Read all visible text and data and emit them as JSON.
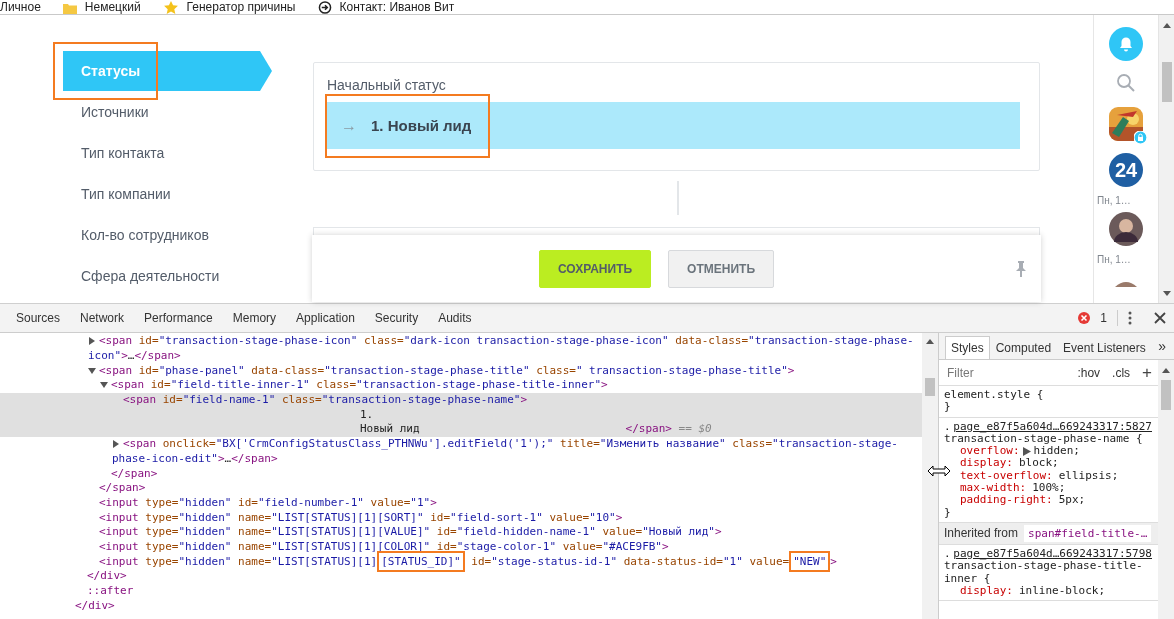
{
  "bookmarks": [
    {
      "label": "Личное",
      "kind": "none"
    },
    {
      "label": "Немецкий",
      "kind": "folder"
    },
    {
      "label": "Генератор причины",
      "kind": "star"
    },
    {
      "label": "Контакт: Иванов Вит",
      "kind": "arrow"
    }
  ],
  "nav": {
    "items": [
      {
        "label": "Статусы",
        "selected": true,
        "outlined": true
      },
      {
        "label": "Источники",
        "selected": false,
        "outlined": false
      },
      {
        "label": "Тип контакта",
        "selected": false,
        "outlined": false
      },
      {
        "label": "Тип компании",
        "selected": false,
        "outlined": false
      },
      {
        "label": "Кол-во сотрудников",
        "selected": false,
        "outlined": false
      },
      {
        "label": "Сфера деятельности",
        "selected": false,
        "outlined": false
      }
    ]
  },
  "status_card": {
    "label": "Начальный статус",
    "stage": {
      "arrow": "→",
      "name": "1. Новый лид",
      "outlined": true
    }
  },
  "footer": {
    "buttons": [
      {
        "label": "СОХРАНИТЬ",
        "kind": "primary"
      },
      {
        "label": "ОТМЕНИТЬ",
        "kind": "secondary"
      }
    ]
  },
  "right_bar": {
    "items": [
      {
        "kind": "bell"
      },
      {
        "kind": "search"
      },
      {
        "kind": "picture"
      },
      {
        "kind": "counter",
        "text": "24",
        "caption": "Пн, 1…"
      },
      {
        "kind": "avatar",
        "caption": "Пн, 1…"
      },
      {
        "kind": "avatar-cut"
      }
    ]
  },
  "devtools": {
    "tabs": [
      {
        "label": "Sources",
        "selected": false
      },
      {
        "label": "Network",
        "selected": false
      },
      {
        "label": "Performance",
        "selected": false
      },
      {
        "label": "Memory",
        "selected": false
      },
      {
        "label": "Application",
        "selected": false
      },
      {
        "label": "Security",
        "selected": false
      },
      {
        "label": "Audits",
        "selected": false
      }
    ],
    "errors": "1",
    "dom_tree": [
      {
        "children": [
          {
            "children": [
              {
                "expanded": false,
                "lines": [
                  [
                    {
                      "kind": "tag",
                      "text": "<span"
                    },
                    {
                      "kind": "attr",
                      "text": " id="
                    },
                    {
                      "kind": "val",
                      "text": "\"transaction-stage-phase-icon\""
                    },
                    {
                      "kind": "attr",
                      "text": " class="
                    },
                    {
                      "kind": "val",
                      "text": "\"dark-icon transaction-stage-phase-icon\""
                    },
                    {
                      "kind": "attr",
                      "text": " data-class="
                    },
                    {
                      "kind": "val",
                      "text": "\"transaction-stage-phase-"
                    }
                  ],
                  [
                    {
                      "kind": "val",
                      "text": "icon\""
                    },
                    {
                      "kind": "tag",
                      "text": ">"
                    },
                    {
                      "kind": "text",
                      "text": "…"
                    },
                    {
                      "kind": "tag",
                      "text": "</span>"
                    }
                  ]
                ]
              },
              {
                "expanded": true,
                "lines": [
                  [
                    {
                      "kind": "tag",
                      "text": "<span"
                    },
                    {
                      "kind": "attr",
                      "text": " id="
                    },
                    {
                      "kind": "val",
                      "text": "\"phase-panel\""
                    },
                    {
                      "kind": "attr",
                      "text": " data-class="
                    },
                    {
                      "kind": "val",
                      "text": "\"transaction-stage-phase-title\""
                    },
                    {
                      "kind": "attr",
                      "text": " class="
                    },
                    {
                      "kind": "val",
                      "text": "\" transaction-stage-phase-title\""
                    },
                    {
                      "kind": "tag",
                      "text": ">"
                    }
                  ]
                ],
                "children": [
                  {
                    "expanded": true,
                    "lines": [
                      [
                        {
                          "kind": "tag",
                          "text": "<span"
                        },
                        {
                          "kind": "attr",
                          "text": " id="
                        },
                        {
                          "kind": "val",
                          "text": "\"field-title-inner-1\""
                        },
                        {
                          "kind": "attr",
                          "text": " class="
                        },
                        {
                          "kind": "val",
                          "text": "\"transaction-stage-phase-title-inner\""
                        },
                        {
                          "kind": "tag",
                          "text": ">"
                        }
                      ]
                    ],
                    "children": [
                      {
                        "selected": true,
                        "lines": [
                          [
                            {
                              "kind": "tag",
                              "text": "<span"
                            },
                            {
                              "kind": "attr",
                              "text": " id="
                            },
                            {
                              "kind": "val",
                              "text": "\"field-name-1\""
                            },
                            {
                              "kind": "attr",
                              "text": " class="
                            },
                            {
                              "kind": "val",
                              "text": "\"transaction-stage-phase-name\""
                            },
                            {
                              "kind": "tag",
                              "text": ">"
                            }
                          ],
                          [
                            {
                              "kind": "content",
                              "text": "1."
                            }
                          ],
                          [
                            {
                              "kind": "content",
                              "text": "Новый лид"
                            },
                            {
                              "kind": "tag",
                              "text": "</span>"
                            },
                            {
                              "kind": "ref",
                              "text": " == $0"
                            }
                          ]
                        ]
                      },
                      {
                        "expanded": false,
                        "lines": [
                          [
                            {
                              "kind": "tag",
                              "text": "<span"
                            },
                            {
                              "kind": "attr",
                              "text": " onclick="
                            },
                            {
                              "kind": "val",
                              "text": "\"BX['CrmConfigStatusClass_PTHNWu'].editField('1');\""
                            },
                            {
                              "kind": "attr",
                              "text": " title="
                            },
                            {
                              "kind": "val",
                              "text": "\"Изменить название\""
                            },
                            {
                              "kind": "attr",
                              "text": " class="
                            },
                            {
                              "kind": "val",
                              "text": "\"transaction-stage-"
                            }
                          ],
                          [
                            {
                              "kind": "val",
                              "text": "phase-icon-edit\""
                            },
                            {
                              "kind": "tag",
                              "text": ">"
                            },
                            {
                              "kind": "text",
                              "text": "…"
                            },
                            {
                              "kind": "tag",
                              "text": "</span>"
                            }
                          ]
                        ]
                      }
                    ],
                    "closing": [
                      {
                        "kind": "tag",
                        "text": "</span>"
                      }
                    ]
                  }
                ],
                "closing": [
                  {
                    "kind": "tag",
                    "text": "</span>"
                  }
                ]
              },
              {
                "lines": [
                  [
                    {
                      "kind": "tag",
                      "text": "<input"
                    },
                    {
                      "kind": "attr",
                      "text": " type="
                    },
                    {
                      "kind": "val",
                      "text": "\"hidden\""
                    },
                    {
                      "kind": "attr",
                      "text": " id="
                    },
                    {
                      "kind": "val",
                      "text": "\"field-number-1\""
                    },
                    {
                      "kind": "attr",
                      "text": " value="
                    },
                    {
                      "kind": "val",
                      "text": "\"1\""
                    },
                    {
                      "kind": "tag",
                      "text": ">"
                    }
                  ]
                ]
              },
              {
                "lines": [
                  [
                    {
                      "kind": "tag",
                      "text": "<input"
                    },
                    {
                      "kind": "attr",
                      "text": " type="
                    },
                    {
                      "kind": "val",
                      "text": "\"hidden\""
                    },
                    {
                      "kind": "attr",
                      "text": " name="
                    },
                    {
                      "kind": "val",
                      "text": "\"LIST[STATUS][1][SORT]\""
                    },
                    {
                      "kind": "attr",
                      "text": " id="
                    },
                    {
                      "kind": "val",
                      "text": "\"field-sort-1\""
                    },
                    {
                      "kind": "attr",
                      "text": " value="
                    },
                    {
                      "kind": "val",
                      "text": "\"10\""
                    },
                    {
                      "kind": "tag",
                      "text": ">"
                    }
                  ]
                ]
              },
              {
                "lines": [
                  [
                    {
                      "kind": "tag",
                      "text": "<input"
                    },
                    {
                      "kind": "attr",
                      "text": " type="
                    },
                    {
                      "kind": "val",
                      "text": "\"hidden\""
                    },
                    {
                      "kind": "attr",
                      "text": " name="
                    },
                    {
                      "kind": "val",
                      "text": "\"LIST[STATUS][1][VALUE]\""
                    },
                    {
                      "kind": "attr",
                      "text": " id="
                    },
                    {
                      "kind": "val",
                      "text": "\"field-hidden-name-1\""
                    },
                    {
                      "kind": "attr",
                      "text": " value="
                    },
                    {
                      "kind": "val",
                      "text": "\"Новый лид\""
                    },
                    {
                      "kind": "tag",
                      "text": ">"
                    }
                  ]
                ]
              },
              {
                "lines": [
                  [
                    {
                      "kind": "tag",
                      "text": "<input"
                    },
                    {
                      "kind": "attr",
                      "text": " type="
                    },
                    {
                      "kind": "val",
                      "text": "\"hidden\""
                    },
                    {
                      "kind": "attr",
                      "text": " name="
                    },
                    {
                      "kind": "val",
                      "text": "\"LIST[STATUS][1][COLOR]\""
                    },
                    {
                      "kind": "attr",
                      "text": " id="
                    },
                    {
                      "kind": "val",
                      "text": "\"stage-color-1\""
                    },
                    {
                      "kind": "attr",
                      "text": " value="
                    },
                    {
                      "kind": "val",
                      "text": "\"#ACE9FB\""
                    },
                    {
                      "kind": "tag",
                      "text": ">"
                    }
                  ]
                ]
              },
              {
                "lines": [
                  [
                    {
                      "kind": "tag",
                      "text": "<input"
                    },
                    {
                      "kind": "attr",
                      "text": " type="
                    },
                    {
                      "kind": "val",
                      "text": "\"hidden\""
                    },
                    {
                      "kind": "attr",
                      "text": " name="
                    },
                    {
                      "kind": "val",
                      "text": "\"LIST[STATUS][1]"
                    },
                    {
                      "kind": "val",
                      "text": "[STATUS_ID]\"",
                      "outlined": true
                    },
                    {
                      "kind": "attr",
                      "text": " id="
                    },
                    {
                      "kind": "val",
                      "text": "\"stage-status-id-1\""
                    },
                    {
                      "kind": "attr",
                      "text": " data-status-id="
                    },
                    {
                      "kind": "val",
                      "text": "\"1\""
                    },
                    {
                      "kind": "attr",
                      "text": " value="
                    },
                    {
                      "kind": "val",
                      "text": "\"NEW\"",
                      "outlined": true
                    },
                    {
                      "kind": "tag",
                      "text": ">"
                    }
                  ]
                ]
              }
            ],
            "closing": [
              {
                "kind": "tag",
                "text": "</div>"
              }
            ]
          },
          {
            "lines": [
              [
                {
                  "kind": "pseudo",
                  "text": "::after"
                }
              ]
            ]
          }
        ],
        "closing": [
          {
            "kind": "tag",
            "text": "</div>"
          }
        ]
      }
    ],
    "styles": {
      "tabs": [
        {
          "label": "Styles",
          "selected": true
        },
        {
          "label": "Computed",
          "selected": false
        },
        {
          "label": "Event Listeners",
          "selected": false
        }
      ],
      "more": "»",
      "filter_placeholder": "Filter",
      "hov": ":hov",
      "cls": ".cls",
      "add": "+",
      "rules": [
        {
          "kind": "element",
          "selector": "element.style {",
          "close": "}"
        },
        {
          "kind": "rule",
          "dot": ".",
          "source": "page_e87f5a604d…669243317:5827",
          "selector": "transaction-stage-phase-name {",
          "declarations": [
            {
              "prop": "overflow:",
              "value": "hidden;",
              "expandable": true
            },
            {
              "prop": "display:",
              "value": "block;",
              "expandable": false
            },
            {
              "prop": "text-overflow:",
              "value": "ellipsis;",
              "expandable": false
            },
            {
              "prop": "max-width:",
              "value": "100%;",
              "expandable": false
            },
            {
              "prop": "padding-right:",
              "value": "5px;",
              "expandable": false
            }
          ],
          "close": "}"
        },
        {
          "kind": "inherited",
          "label": "Inherited from",
          "target": "span#field-title-…"
        },
        {
          "kind": "rule",
          "dot": ".",
          "source": "page_e87f5a604d…669243317:5798",
          "selector": "transaction-stage-phase-title-inner {",
          "declarations": [
            {
              "prop": "display:",
              "value": "inline-block;",
              "expandable": false
            }
          ]
        }
      ]
    }
  }
}
